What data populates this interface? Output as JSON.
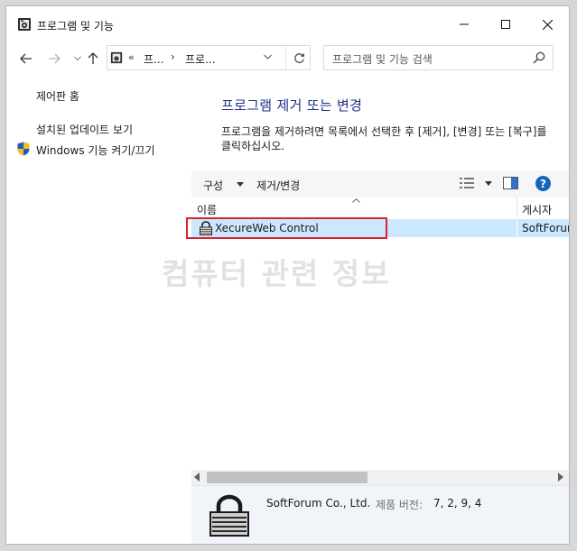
{
  "window": {
    "title": "프로그램 및 기능"
  },
  "address": {
    "overflow": "«",
    "crumb1": "프...",
    "crumb2": "프로..."
  },
  "search": {
    "placeholder": "프로그램 및 기능 검색"
  },
  "sidebar": {
    "items": [
      {
        "label": "제어판 홈"
      },
      {
        "label": "설치된 업데이트 보기"
      },
      {
        "label": "Windows 기능 켜기/끄기"
      }
    ]
  },
  "main": {
    "heading": "프로그램 제거 또는 변경",
    "description": "프로그램을 제거하려면 목록에서 선택한 후 [제거], [변경] 또는 [복구]를 클릭하십시오."
  },
  "toolbar": {
    "organize_label": "구성",
    "uninstall_change_label": "제거/변경"
  },
  "list": {
    "columns": [
      "이름",
      "게시자"
    ],
    "rows": [
      {
        "name": "XecureWeb Control",
        "publisher": "SoftForum"
      }
    ]
  },
  "watermark": "컴퓨터 관련 정보",
  "details": {
    "publisher": "SoftForum Co., Ltd.",
    "version_label": "제품 버전:",
    "version": "7, 2, 9, 4"
  },
  "colors": {
    "heading": "#1e3287",
    "selection": "#cce8ff",
    "highlight_border": "#d9232e"
  }
}
